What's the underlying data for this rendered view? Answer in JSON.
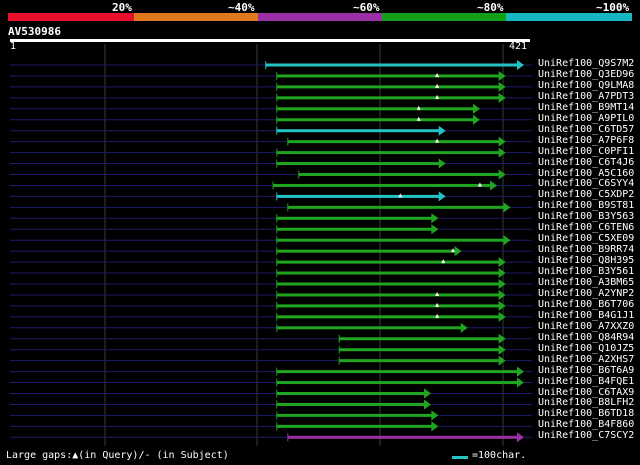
{
  "header": {
    "identity_labels": [
      "20%",
      "~40%",
      "~60%",
      "~80%",
      "~100%"
    ],
    "identity_colors": [
      "#e8102a",
      "#e07820",
      "#9b2fa6",
      "#13a016",
      "#16b7c2"
    ]
  },
  "query": {
    "id": "AV530986",
    "start": "1",
    "end": "421",
    "length": 421
  },
  "colors": {
    "cyan": "#22c3c3",
    "green": "#1fa51f",
    "purple": "#9b2fa6",
    "gridline": "#1c1c6a",
    "vline": "#3a3a3a"
  },
  "hits": [
    {
      "name": "UniRef100_Q9S7M2",
      "start": 210,
      "end": 421,
      "color": "cyan",
      "gaps": []
    },
    {
      "name": "UniRef100_Q3ED96",
      "start": 219,
      "end": 406,
      "color": "green",
      "gaps": [
        350
      ]
    },
    {
      "name": "UniRef100_Q9LMA8",
      "start": 219,
      "end": 406,
      "color": "green",
      "gaps": [
        350
      ]
    },
    {
      "name": "UniRef100_A7PDT3",
      "start": 219,
      "end": 406,
      "color": "green",
      "gaps": [
        350
      ]
    },
    {
      "name": "UniRef100_B9MT14",
      "start": 219,
      "end": 385,
      "color": "green",
      "gaps": [
        335
      ]
    },
    {
      "name": "UniRef100_A9PIL0",
      "start": 219,
      "end": 385,
      "color": "green",
      "gaps": [
        335
      ]
    },
    {
      "name": "UniRef100_C6TD57",
      "start": 219,
      "end": 357,
      "color": "cyan",
      "gaps": []
    },
    {
      "name": "UniRef100_A7P6F8",
      "start": 228,
      "end": 406,
      "color": "green",
      "gaps": [
        350
      ]
    },
    {
      "name": "UniRef100_C0PFI1",
      "start": 219,
      "end": 406,
      "color": "green",
      "gaps": []
    },
    {
      "name": "UniRef100_C6T4J6",
      "start": 219,
      "end": 357,
      "color": "green",
      "gaps": []
    },
    {
      "name": "UniRef100_A5C160",
      "start": 237,
      "end": 406,
      "color": "green",
      "gaps": []
    },
    {
      "name": "UniRef100_C6SYY4",
      "start": 216,
      "end": 399,
      "color": "green",
      "gaps": [
        385
      ]
    },
    {
      "name": "UniRef100_C5XDP2",
      "start": 219,
      "end": 357,
      "color": "cyan",
      "gaps": [
        320
      ]
    },
    {
      "name": "UniRef100_B9ST81",
      "start": 228,
      "end": 410,
      "color": "green",
      "gaps": []
    },
    {
      "name": "UniRef100_B3Y563",
      "start": 219,
      "end": 351,
      "color": "green",
      "gaps": []
    },
    {
      "name": "UniRef100_C6TEN6",
      "start": 219,
      "end": 351,
      "color": "green",
      "gaps": []
    },
    {
      "name": "UniRef100_C5XE09",
      "start": 219,
      "end": 410,
      "color": "green",
      "gaps": []
    },
    {
      "name": "UniRef100_B9RR74",
      "start": 219,
      "end": 370,
      "color": "green",
      "gaps": [
        363
      ]
    },
    {
      "name": "UniRef100_Q8H395",
      "start": 219,
      "end": 406,
      "color": "green",
      "gaps": [
        355
      ]
    },
    {
      "name": "UniRef100_B3Y561",
      "start": 219,
      "end": 406,
      "color": "green",
      "gaps": []
    },
    {
      "name": "UniRef100_A3BM65",
      "start": 219,
      "end": 406,
      "color": "green",
      "gaps": []
    },
    {
      "name": "UniRef100_A2YNP2",
      "start": 219,
      "end": 406,
      "color": "green",
      "gaps": [
        350
      ]
    },
    {
      "name": "UniRef100_B6T706",
      "start": 219,
      "end": 406,
      "color": "green",
      "gaps": [
        350
      ]
    },
    {
      "name": "UniRef100_B4G1J1",
      "start": 219,
      "end": 406,
      "color": "green",
      "gaps": [
        350
      ]
    },
    {
      "name": "UniRef100_A7XXZ0",
      "start": 219,
      "end": 375,
      "color": "green",
      "gaps": []
    },
    {
      "name": "UniRef100_Q84R94",
      "start": 270,
      "end": 406,
      "color": "green",
      "gaps": []
    },
    {
      "name": "UniRef100_Q10JZ5",
      "start": 270,
      "end": 406,
      "color": "green",
      "gaps": []
    },
    {
      "name": "UniRef100_A2XHS7",
      "start": 270,
      "end": 406,
      "color": "green",
      "gaps": []
    },
    {
      "name": "UniRef100_B6T6A9",
      "start": 219,
      "end": 421,
      "color": "green",
      "gaps": []
    },
    {
      "name": "UniRef100_B4FQE1",
      "start": 219,
      "end": 421,
      "color": "green",
      "gaps": []
    },
    {
      "name": "UniRef100_C6TAX9",
      "start": 219,
      "end": 345,
      "color": "green",
      "gaps": []
    },
    {
      "name": "UniRef100_B8LFH2",
      "start": 219,
      "end": 345,
      "color": "green",
      "gaps": []
    },
    {
      "name": "UniRef100_B6TD18",
      "start": 219,
      "end": 351,
      "color": "green",
      "gaps": []
    },
    {
      "name": "UniRef100_B4F860",
      "start": 219,
      "end": 351,
      "color": "green",
      "gaps": []
    },
    {
      "name": "UniRef100_C7SCY2",
      "start": 228,
      "end": 421,
      "color": "purple",
      "gaps": []
    }
  ],
  "legend": {
    "gaps_text": "Large gaps:▲(in Query)/- (in Subject)",
    "scale_text": "=100char."
  }
}
